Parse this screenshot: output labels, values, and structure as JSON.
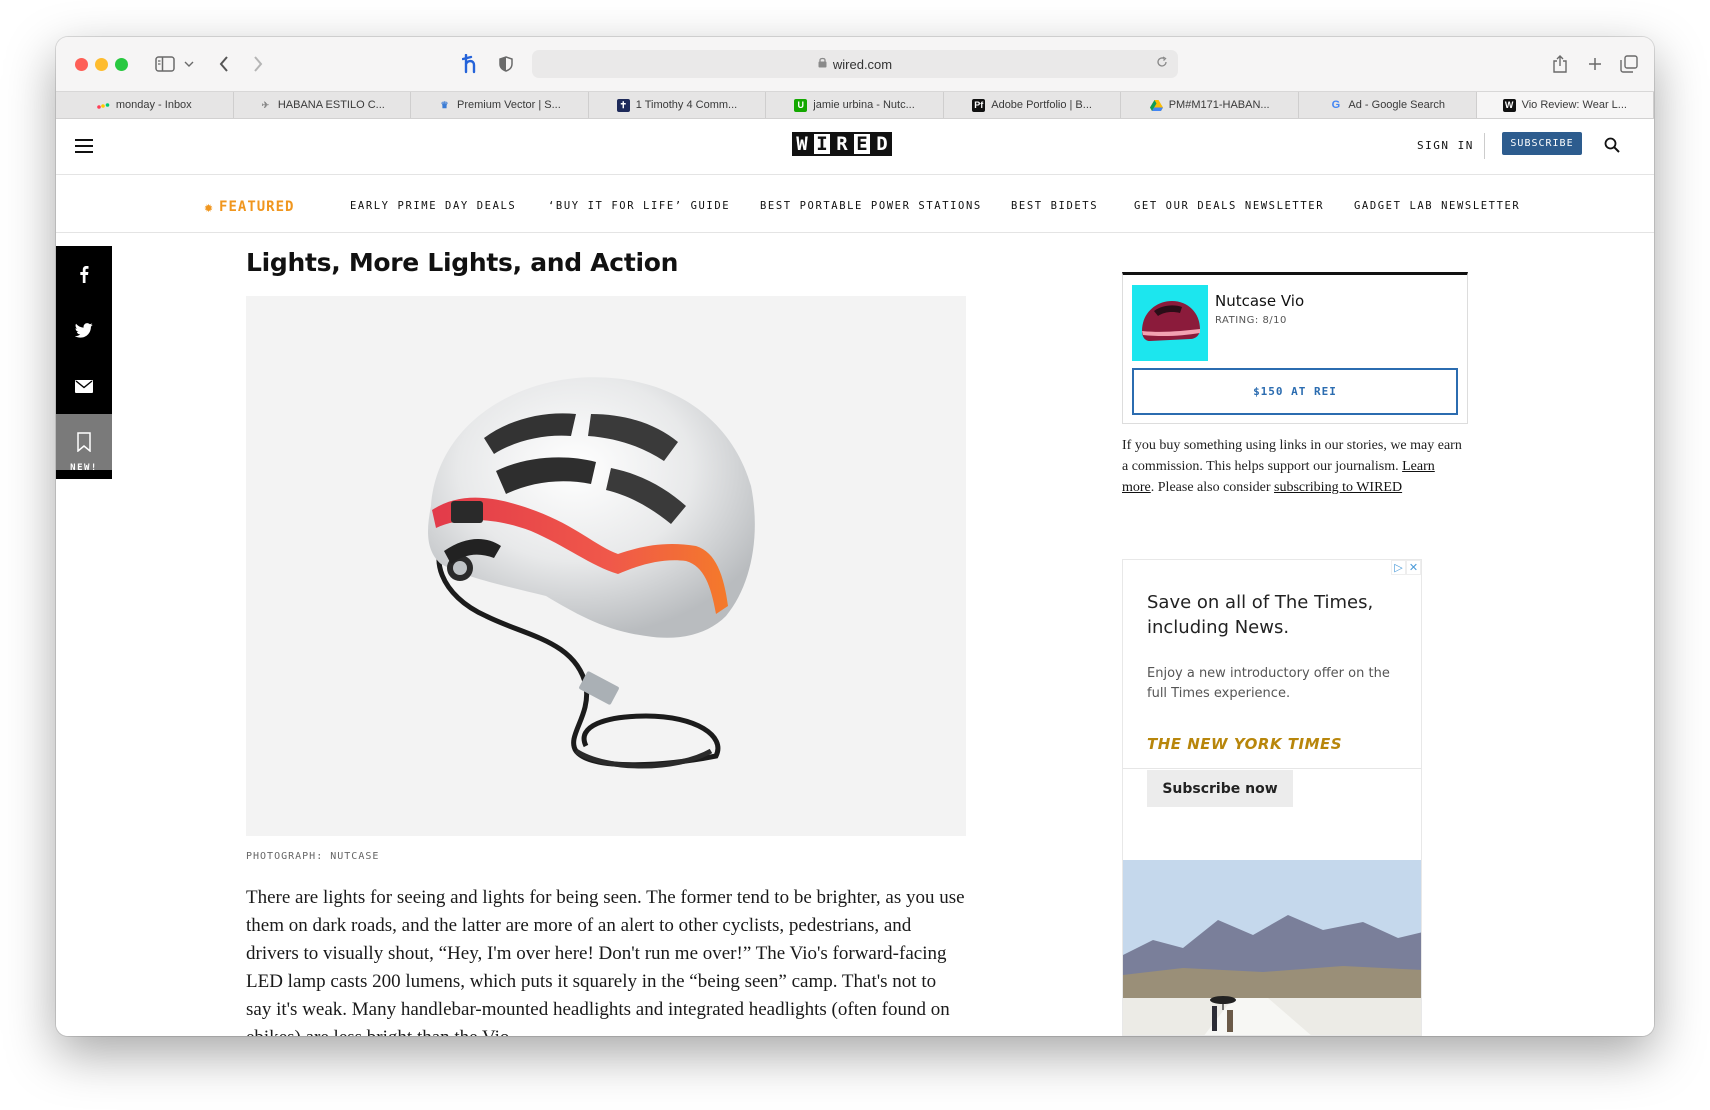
{
  "browser": {
    "url": "wired.com",
    "tabs": [
      {
        "label": "monday - Inbox",
        "favicon": "monday-icon",
        "color": "#ff3d57"
      },
      {
        "label": "HABANA ESTILO C...",
        "favicon": "plane-icon",
        "color": "#888888"
      },
      {
        "label": "Premium Vector | S...",
        "favicon": "crown-icon",
        "color": "#3a7bd5"
      },
      {
        "label": "1 Timothy 4 Comm...",
        "favicon": "cross-icon",
        "color": "#1e2a5a"
      },
      {
        "label": "jamie urbina - Nutc...",
        "favicon": "upwork-icon",
        "color": "#14a800"
      },
      {
        "label": "Adobe Portfolio | B...",
        "favicon": "portfolio-icon",
        "color": "#111111"
      },
      {
        "label": "PM#M171-HABAN...",
        "favicon": "drive-icon",
        "color": "#fbbc04"
      },
      {
        "label": "Ad - Google Search",
        "favicon": "google-icon",
        "color": "#4285f4"
      },
      {
        "label": "Vio Review: Wear L...",
        "favicon": "wired-icon",
        "color": "#111111"
      }
    ]
  },
  "header": {
    "logo": [
      "W",
      "I",
      "R",
      "E",
      "D"
    ],
    "sign_in": "SIGN IN",
    "subscribe": "SUBSCRIBE"
  },
  "subnav": {
    "featured": "FEATURED",
    "links": [
      "EARLY PRIME DAY DEALS",
      "‘BUY IT FOR LIFE’ GUIDE",
      "BEST PORTABLE POWER STATIONS",
      "BEST BIDETS",
      "GET OUR DEALS NEWSLETTER",
      "GADGET LAB NEWSLETTER"
    ]
  },
  "share": {
    "new_label": "NEW!"
  },
  "article": {
    "title": "Lights, More Lights, and Action",
    "photo_caption": "PHOTOGRAPH: NUTCASE",
    "body": "There are lights for seeing and lights for being seen. The former tend to be brighter, as you use them on dark roads, and the latter are more of an alert to other cyclists, pedestrians, and drivers to visually shout, “Hey, I'm over here! Don't run me over!” The Vio's forward-facing LED lamp casts 200 lumens, which puts it squarely in the “being seen” camp. That's not to say it's weak. Many handlebar-mounted headlights and integrated headlights (often found on ebikes) are less bright than the Vio."
  },
  "product": {
    "name": "Nutcase Vio",
    "rating": "RATING: 8/10",
    "buy_label": "$150 AT REI"
  },
  "disclaimer": {
    "text_1": "If you buy something using links in our stories, we may earn a commission. This helps support our journalism.",
    "learn_more": "Learn more",
    "text_2": ". Please also consider ",
    "subscribe_link": "subscribing to WIRED"
  },
  "ad": {
    "headline": "Save on all of The Times, including News.",
    "sub": "Enjoy a new introductory offer on the full Times experience.",
    "brand": "THE NEW YORK TIMES",
    "cta": "Subscribe now"
  },
  "colors": {
    "subscribe_bg": "#2d5c8e",
    "featured": "#f0961e",
    "buy_button": "#2b6cb0",
    "ad_brand": "#b8860b"
  }
}
